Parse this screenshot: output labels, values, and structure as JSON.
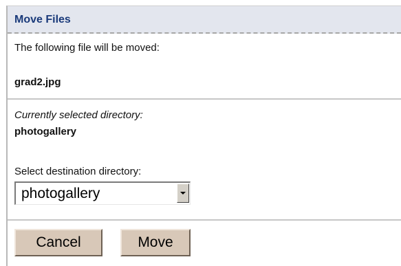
{
  "panel": {
    "title": "Move Files"
  },
  "file_section": {
    "intro": "The following file will be moved:",
    "filename": "grad2.jpg"
  },
  "directory_section": {
    "current_label": "Currently selected directory:",
    "current_value": "photogallery",
    "destination_label": "Select destination directory:",
    "destination_selected": "photogallery"
  },
  "actions": {
    "cancel_label": "Cancel",
    "move_label": "Move"
  },
  "icons": {
    "select_arrow": "chevron-down-icon"
  },
  "colors": {
    "header_bg": "#e3e6ee",
    "header_text": "#1a3a7a",
    "button_bg": "#d8c8b8"
  }
}
